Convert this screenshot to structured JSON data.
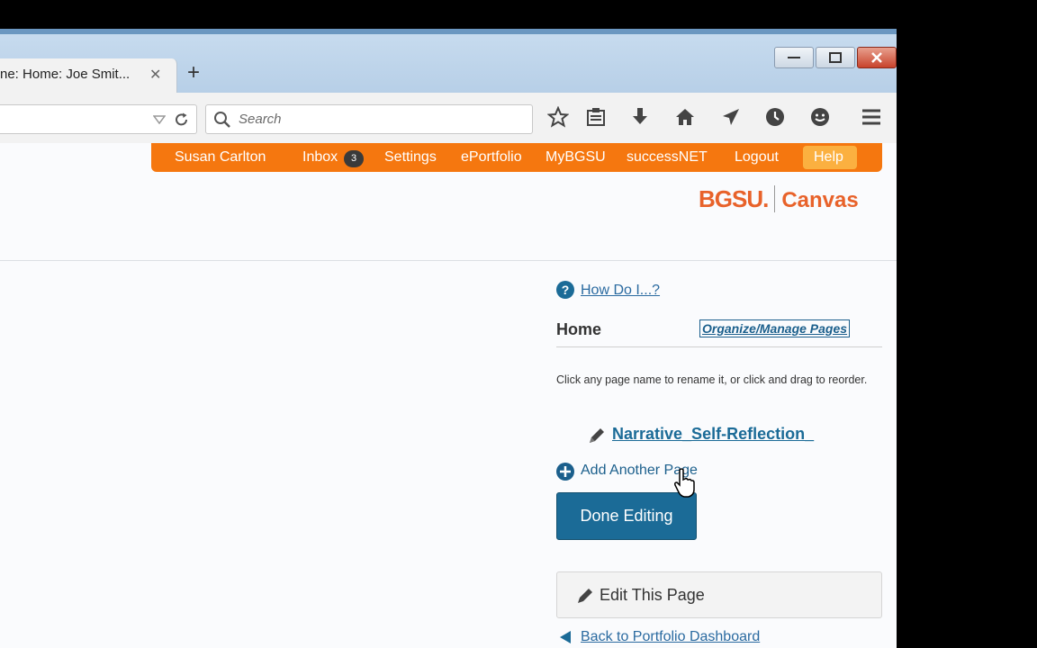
{
  "browser": {
    "tab_title": "ne: Home: Joe Smit...",
    "tab_close": "✕",
    "new_tab": "+",
    "search_placeholder": "Search"
  },
  "topnav": {
    "user": "Susan Carlton",
    "inbox": "Inbox",
    "inbox_count": "3",
    "settings": "Settings",
    "eportfolio": "ePortfolio",
    "mybgsu": "MyBGSU",
    "successnet": "successNET",
    "logout": "Logout",
    "help": "Help"
  },
  "brand": {
    "bgsu": "BGSU.",
    "canvas": "Canvas",
    "bgsu_color": "#e8622a",
    "canvas_color": "#e8622a"
  },
  "sidebar": {
    "how_do_i": "How Do I...?",
    "home": "Home",
    "organize": "Organize/Manage Pages",
    "instructions": "Click any page name to rename it, or click and drag to reorder.",
    "page_item": "Narrative_Self-Reflection_",
    "add_page": "Add Another Page",
    "done": "Done Editing",
    "edit": "Edit This Page",
    "back": "Back to Portfolio Dashboard"
  }
}
